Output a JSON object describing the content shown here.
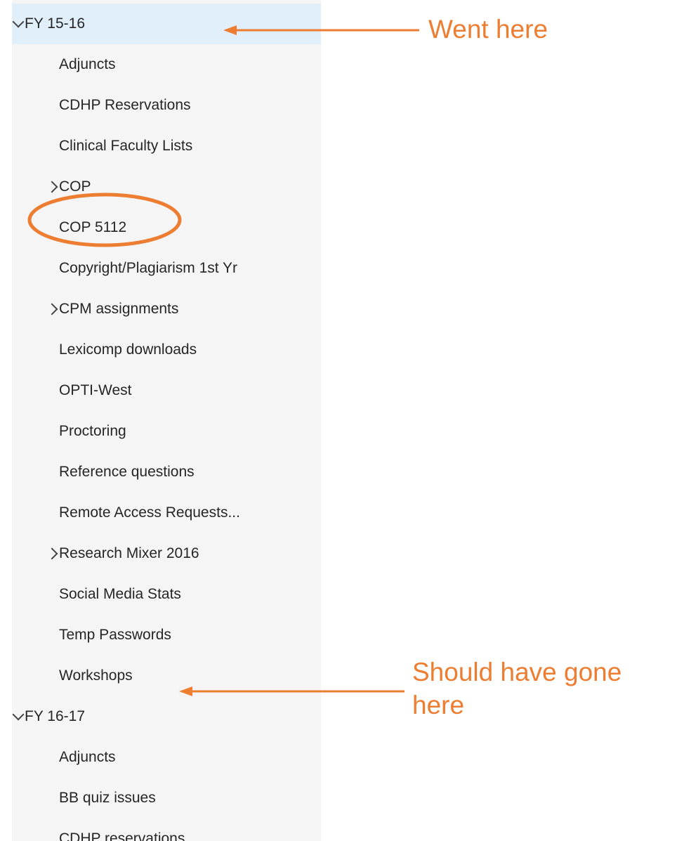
{
  "folder_tree": {
    "items": [
      {
        "label": "FY 15-16",
        "expander": "expanded",
        "level": 0,
        "selected": true
      },
      {
        "label": "Adjuncts",
        "expander": "none",
        "level": 1
      },
      {
        "label": "CDHP Reservations",
        "expander": "none",
        "level": 1
      },
      {
        "label": "Clinical Faculty Lists",
        "expander": "none",
        "level": 1
      },
      {
        "label": "COP",
        "expander": "collapsed",
        "level": 1
      },
      {
        "label": "COP 5112",
        "expander": "none",
        "level": 1
      },
      {
        "label": "Copyright/Plagiarism 1st Yr",
        "expander": "none",
        "level": 1
      },
      {
        "label": "CPM assignments",
        "expander": "collapsed",
        "level": 1
      },
      {
        "label": "Lexicomp downloads",
        "expander": "none",
        "level": 1
      },
      {
        "label": "OPTI-West",
        "expander": "none",
        "level": 1
      },
      {
        "label": "Proctoring",
        "expander": "none",
        "level": 1
      },
      {
        "label": "Reference questions",
        "expander": "none",
        "level": 1
      },
      {
        "label": "Remote Access Requests...",
        "expander": "none",
        "level": 1
      },
      {
        "label": "Research Mixer 2016",
        "expander": "collapsed",
        "level": 1
      },
      {
        "label": "Social Media Stats",
        "expander": "none",
        "level": 1
      },
      {
        "label": "Temp Passwords",
        "expander": "none",
        "level": 1
      },
      {
        "label": "Workshops",
        "expander": "none",
        "level": 1
      },
      {
        "label": "FY 16-17",
        "expander": "expanded",
        "level": 0
      },
      {
        "label": "Adjuncts",
        "expander": "none",
        "level": 1
      },
      {
        "label": "BB quiz issues",
        "expander": "none",
        "level": 1
      },
      {
        "label": "CDHP reservations",
        "expander": "none",
        "level": 1
      }
    ]
  },
  "annotations": {
    "went_here": "Went here",
    "should_have_gone_line1": "Should have gone",
    "should_have_gone_line2": "here",
    "accent_color": "#ed7d31",
    "circled_item": "COP 5112"
  },
  "colors": {
    "pane_background": "#f5f5f5",
    "selected_row": "#e1effa",
    "text": "#262626"
  },
  "icons": {
    "expanded": "chevron-down-icon",
    "collapsed": "chevron-right-icon"
  }
}
